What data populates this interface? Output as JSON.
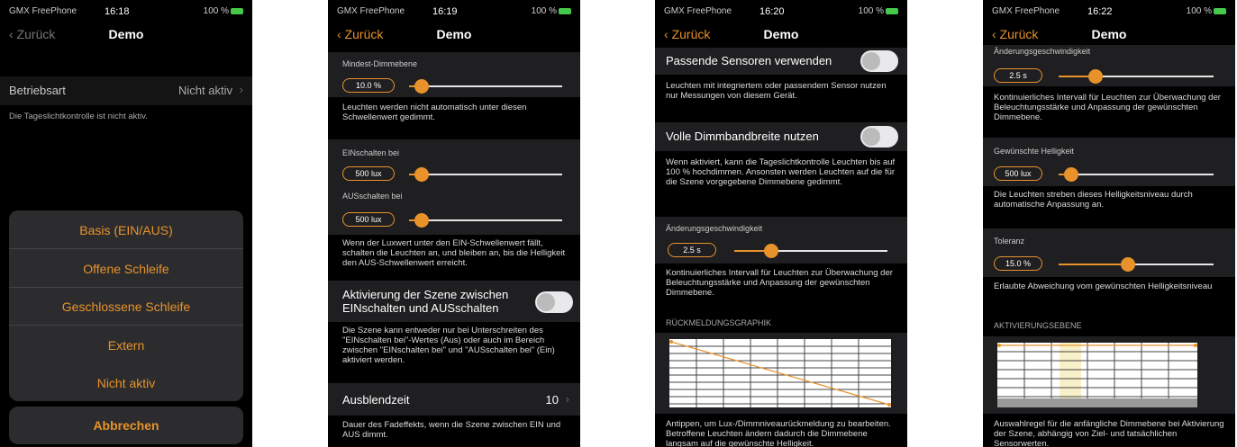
{
  "common": {
    "carrier": "GMX FreePhone",
    "battery": "100 %",
    "back_label": "Zurück",
    "title": "Demo"
  },
  "colors": {
    "accent": "#e8922b",
    "background": "#000000",
    "group": "#1f1f21"
  },
  "screen1": {
    "time": "16:18",
    "mode_label": "Betriebsart",
    "mode_value": "Nicht aktiv",
    "inactive_note": "Die Tageslichtkontrolle ist nicht aktiv.",
    "options": [
      "Basis (EIN/AUS)",
      "Offene Schleife",
      "Geschlossene Schleife",
      "Extern",
      "Nicht aktiv"
    ],
    "cancel": "Abbrechen"
  },
  "screen2": {
    "time": "16:19",
    "min_dim_label": "Mindest-Dimmebene",
    "min_dim_value": "10.0 %",
    "min_dim_level": 0.08,
    "min_dim_note": "Leuchten werden nicht automatisch unter diesen Schwellenwert gedimmt.",
    "on_label": "EINschalten bei",
    "on_value": "500 lux",
    "on_level": 0.08,
    "off_label": "AUSschalten bei",
    "off_value": "500 lux",
    "off_level": 0.08,
    "threshold_note": "Wenn der Luxwert unter den EIN-Schwellenwert fällt, schalten die Leuchten an, und bleiben an, bis die Helligkeit den AUS-Schwellenwert erreicht.",
    "scene_toggle_label": "Aktivierung der Szene zwischen EINschalten und AUSschalten",
    "scene_note": "Die Szene kann entweder nur bei Unterschreiten des \"EINschalten bei\"-Wertes (Aus) oder auch im Bereich zwischen \"EINschalten bei\" und \"AUSschalten bei\" (Ein) aktiviert werden.",
    "fade_label": "Ausblendzeit",
    "fade_value": "10",
    "fade_note": "Dauer des Fadeffekts, wenn die Szene zwischen EIN und AUS dimmt."
  },
  "screen3": {
    "time": "16:20",
    "sensor_toggle_label": "Passende Sensoren verwenden",
    "sensor_note": "Leuchten mit integriertem oder passendem Sensor nutzen nur Messungen von diesem Gerät.",
    "full_range_label": "Volle Dimmbandbreite nutzen",
    "full_range_note": "Wenn aktiviert, kann die Tageslichtkontrolle Leuchten bis auf 100 % hochdimmen. Ansonsten werden Leuchten auf die für die Szene vorgegebene Dimmebene gedimmt.",
    "speed_label": "Änderungsgeschwindigkeit",
    "speed_value": "2.5 s",
    "speed_level": 0.24,
    "speed_note": "Kontinuierliches Intervall für Leuchten zur Überwachung der Beleuchtungsstärke und Anpassung der gewünschten Dimmebene.",
    "feedback_header": "RÜCKMELDUNGSGRAPHIK",
    "feedback_note": "Antippen, um Lux-/Dimmniveaurückmeldung zu bearbeiten. Betroffene Leuchten ändern dadurch die Dimmebene langsam auf die gewünschte Helligkeit."
  },
  "screen4": {
    "time": "16:22",
    "speed_label": "Änderungsgeschwindigkeit",
    "speed_value": "2.5 s",
    "speed_level": 0.24,
    "speed_note": "Kontinuierliches Intervall für Leuchten zur Überwachung der Beleuchtungsstärke und Anpassung der gewünschten Dimmebene.",
    "brightness_label": "Gewünschte Helligkeit",
    "brightness_value": "500 lux",
    "brightness_level": 0.08,
    "brightness_note": "Die Leuchten streben dieses Helligkeitsniveau durch automatische Anpassung an.",
    "tolerance_label": "Toleranz",
    "tolerance_value": "15.0 %",
    "tolerance_level": 0.45,
    "tolerance_note": "Erlaubte Abweichung vom gewünschten Helligkeitsniveau",
    "activation_header": "AKTIVIERUNGSEBENE",
    "activation_note": "Auswahlregel für die anfängliche Dimmebene bei Aktivierung der Szene, abhängig von Ziel- und tatsächlichen Sensorwerten."
  }
}
